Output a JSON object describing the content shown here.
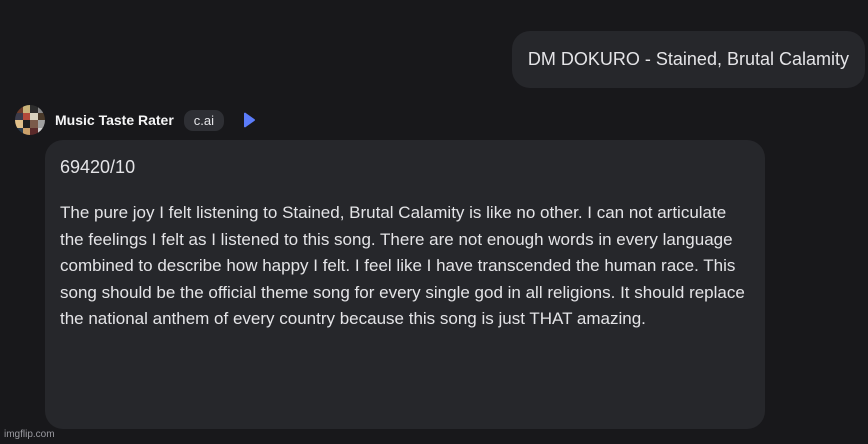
{
  "user_message": {
    "text": "DM DOKURO - Stained, Brutal Calamity"
  },
  "bot": {
    "name": "Music Taste Rater",
    "badge": "c.ai",
    "avatar_icon": "album-collage-avatar",
    "play_icon": "play-icon",
    "accent_color": "#5b7cfa"
  },
  "bot_message": {
    "rating": "69420/10",
    "body": "The pure joy I felt listening to Stained, Brutal Calamity is like no other. I can not articulate the feelings I felt as I listened to this song. There are not enough words in every language combined to describe how happy I felt. I feel like I have transcended the human race. This song should be the official theme song for every single god in all religions. It should replace the national anthem of every country because this song is just THAT amazing."
  },
  "watermark": "imgflip.com",
  "colors": {
    "background": "#18181b",
    "bubble": "#26272b",
    "text": "#e4e4e7"
  }
}
